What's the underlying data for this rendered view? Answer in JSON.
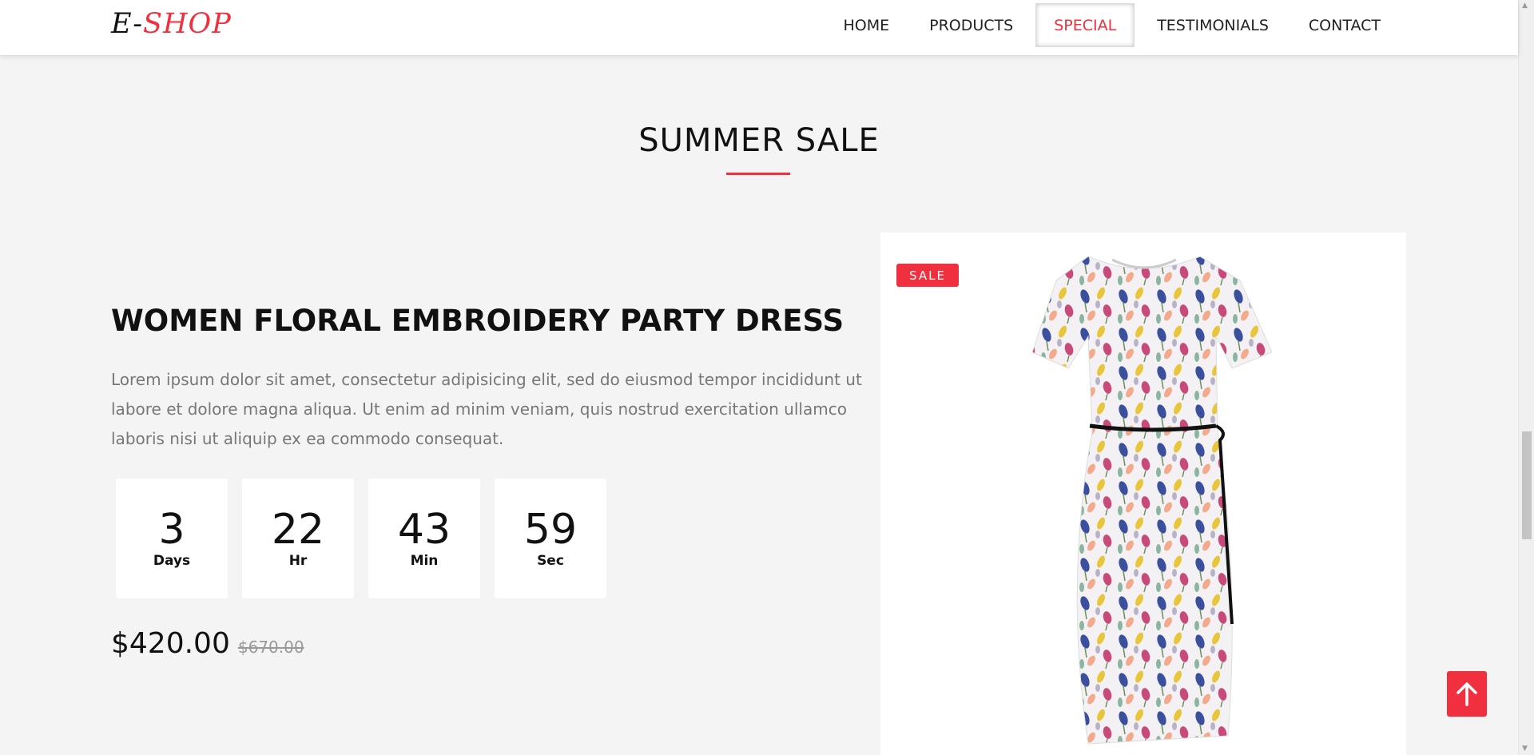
{
  "brand": {
    "prefix": "E-",
    "accent": "SHOP"
  },
  "nav": [
    {
      "label": "HOME",
      "active": false
    },
    {
      "label": "PRODUCTS",
      "active": false
    },
    {
      "label": "SPECIAL",
      "active": true
    },
    {
      "label": "TESTIMONIALS",
      "active": false
    },
    {
      "label": "CONTACT",
      "active": false
    }
  ],
  "section": {
    "title": "SUMMER SALE"
  },
  "product": {
    "name": "WOMEN FLORAL EMBROIDERY PARTY DRESS",
    "description": "Lorem ipsum dolor sit amet, consectetur adipisicing elit, sed do eiusmod tempor incididunt ut labore et dolore magna aliqua. Ut enim ad minim veniam, quis nostrud exercitation ullamco laboris nisi ut aliquip ex ea commodo consequat.",
    "price": "$420.00",
    "old_price": "$670.00",
    "badge": "SALE",
    "image_icon": "floral-dress-image"
  },
  "countdown": [
    {
      "value": "3",
      "unit": "Days"
    },
    {
      "value": "22",
      "unit": "Hr"
    },
    {
      "value": "43",
      "unit": "Min"
    },
    {
      "value": "59",
      "unit": "Sec"
    }
  ],
  "back_to_top": {
    "icon": "arrow-up-icon"
  },
  "colors": {
    "accent": "#f0303e",
    "background": "#f4f4f4",
    "text": "#111111",
    "muted": "#777777"
  }
}
